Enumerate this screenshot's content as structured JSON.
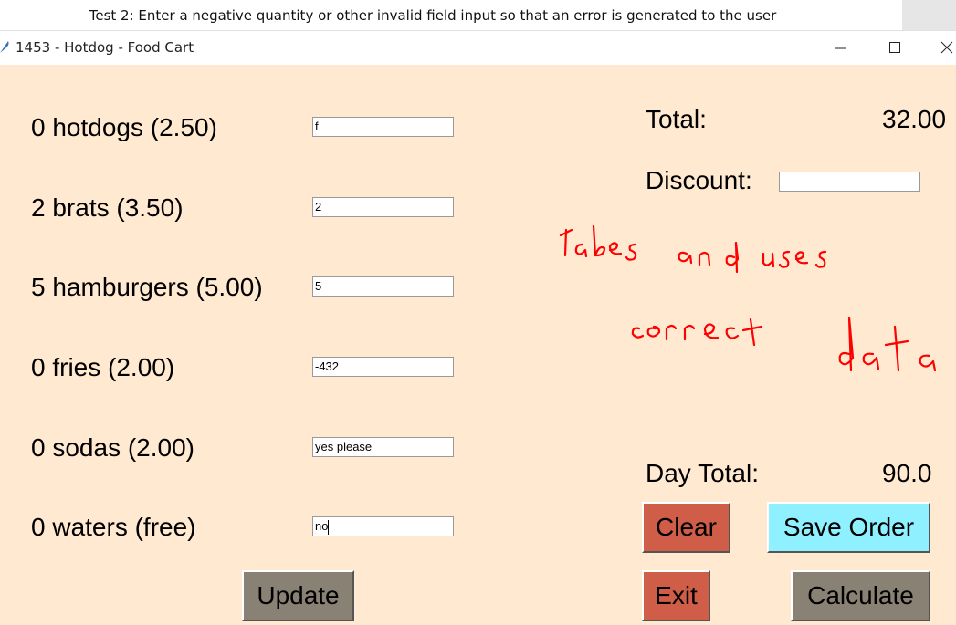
{
  "caption": "Test 2: Enter a negative quantity or other invalid field input so that an error is generated to the user",
  "window": {
    "title": "1453 - Hotdog - Food Cart",
    "icon": "feather-icon",
    "controls": [
      "minimize-icon",
      "maximize-icon",
      "close-icon"
    ]
  },
  "items": [
    {
      "label": "0 hotdogs (2.50)",
      "value": "f"
    },
    {
      "label": "2 brats (3.50)",
      "value": "2"
    },
    {
      "label": "5 hamburgers (5.00)",
      "value": "5"
    },
    {
      "label": "0 fries (2.00)",
      "value": "-432"
    },
    {
      "label": "0 sodas (2.00)",
      "value": "yes please"
    },
    {
      "label": "0 waters (free)",
      "value": "no"
    }
  ],
  "total": {
    "label": "Total:",
    "value": "32.00"
  },
  "discount": {
    "label": "Discount:",
    "value": ""
  },
  "day_total": {
    "label": "Day Total:",
    "value": "90.0"
  },
  "buttons": {
    "update": "Update",
    "clear": "Clear",
    "save_order": "Save Order",
    "exit": "Exit",
    "calculate": "Calculate"
  },
  "annotation": "takes and uses correct data",
  "colors": {
    "background": "#ffe9d1",
    "update_button": "#8a8175",
    "clear_button": "#cf5d48",
    "save_button": "#8ff0ff",
    "exit_button": "#cf5d48",
    "calculate_button": "#8a8175",
    "annotation_ink": "#ff0000"
  }
}
